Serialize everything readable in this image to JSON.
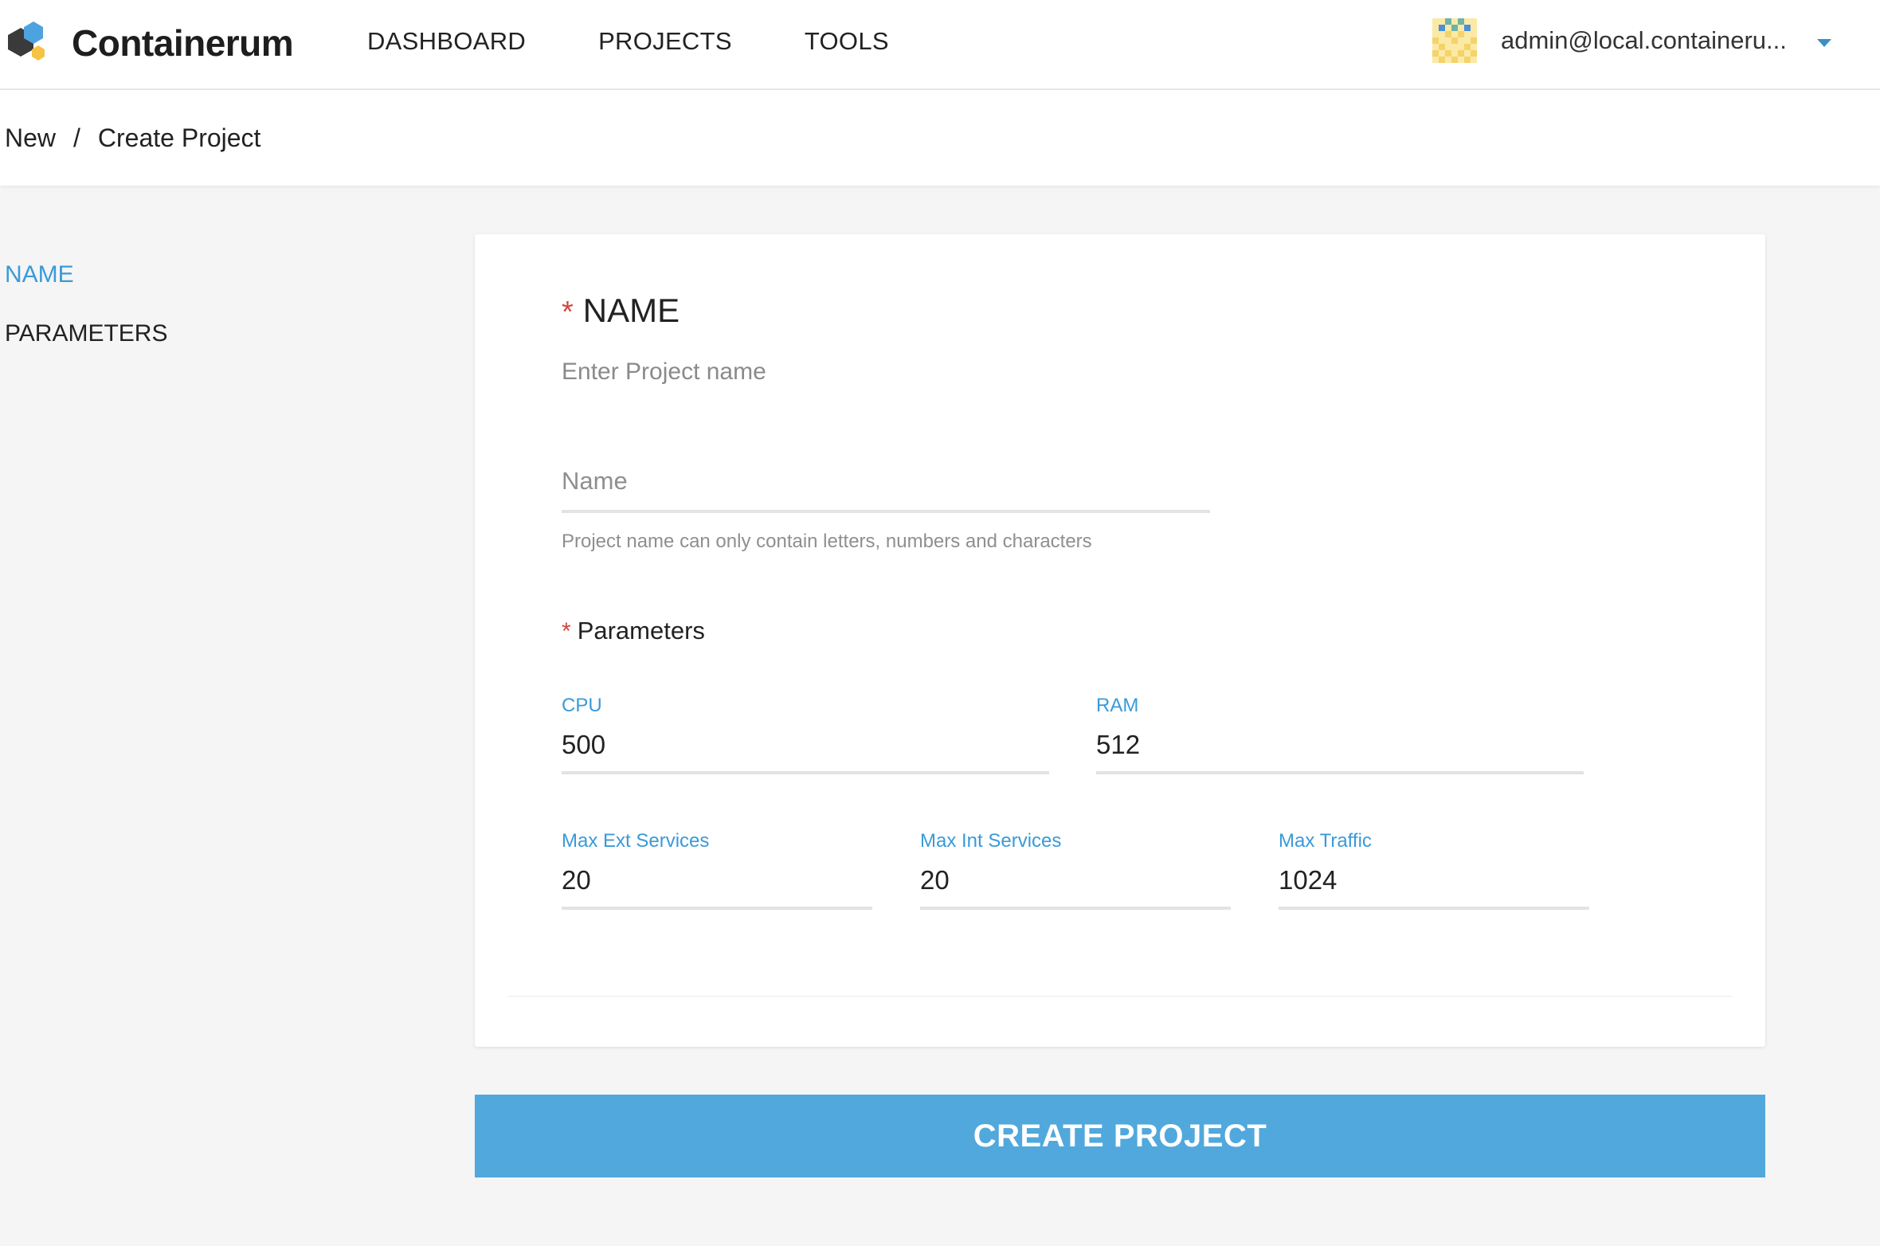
{
  "header": {
    "brand": "Containerum",
    "brand_colors": {
      "dark": "#3a3a3a",
      "blue": "#4da3de",
      "yellow": "#f6c344"
    },
    "nav": [
      {
        "label": "DASHBOARD"
      },
      {
        "label": "PROJECTS"
      },
      {
        "label": "TOOLS"
      }
    ],
    "user": {
      "email": "admin@local.containeru...",
      "avatar_icon": "identicon"
    }
  },
  "breadcrumb": {
    "items": [
      "New",
      "Create Project"
    ],
    "separator": "/"
  },
  "sidenav": {
    "items": [
      {
        "label": "NAME",
        "active": true
      },
      {
        "label": "PARAMETERS",
        "active": false
      }
    ]
  },
  "form": {
    "name_section": {
      "required_mark": "*",
      "title": "NAME",
      "subtitle": "Enter Project name",
      "name_placeholder": "Name",
      "name_value": "",
      "hint": "Project name can only contain letters, numbers and characters"
    },
    "params_section": {
      "required_mark": "*",
      "title": "Parameters",
      "cpu": {
        "label": "CPU",
        "value": "500"
      },
      "ram": {
        "label": "RAM",
        "value": "512"
      },
      "max_ext": {
        "label": "Max Ext Services",
        "value": "20"
      },
      "max_int": {
        "label": "Max Int Services",
        "value": "20"
      },
      "max_traffic": {
        "label": "Max Traffic",
        "value": "1024"
      }
    }
  },
  "actions": {
    "create_label": "CREATE PROJECT",
    "accent": "#51a8dc"
  }
}
